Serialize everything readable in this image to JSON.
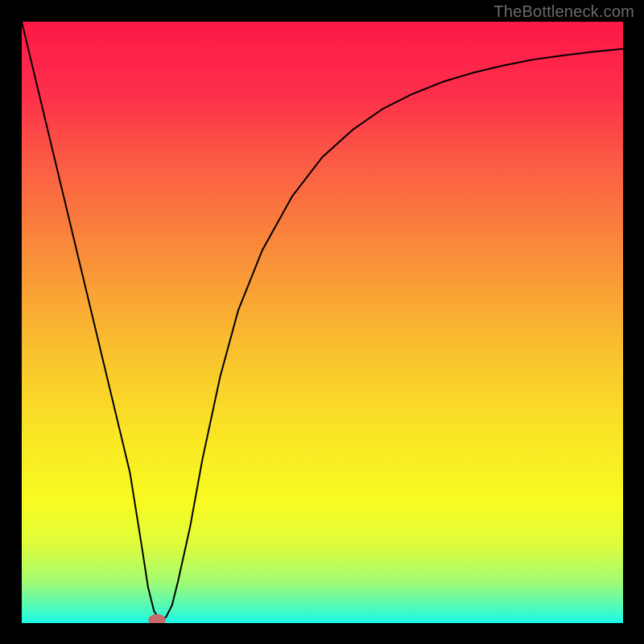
{
  "watermark": "TheBottleneck.com",
  "chart_data": {
    "type": "line",
    "title": "",
    "xlabel": "",
    "ylabel": "",
    "xlim": [
      0,
      100
    ],
    "ylim": [
      0,
      100
    ],
    "grid": false,
    "legend": false,
    "background_gradient": {
      "type": "vertical",
      "stops": [
        {
          "offset": 0.0,
          "color": "#fd1847"
        },
        {
          "offset": 0.12,
          "color": "#fd2f4b"
        },
        {
          "offset": 0.25,
          "color": "#fb6143"
        },
        {
          "offset": 0.4,
          "color": "#f99239"
        },
        {
          "offset": 0.55,
          "color": "#f9c22e"
        },
        {
          "offset": 0.7,
          "color": "#f9e924"
        },
        {
          "offset": 0.8,
          "color": "#f8fb22"
        },
        {
          "offset": 0.87,
          "color": "#defc3c"
        },
        {
          "offset": 0.93,
          "color": "#a4fb70"
        },
        {
          "offset": 0.97,
          "color": "#57fab3"
        },
        {
          "offset": 1.0,
          "color": "#1afae9"
        }
      ]
    },
    "series": [
      {
        "name": "bottleneck-curve",
        "color": "#000000",
        "stroke_width": 2,
        "x": [
          0,
          3,
          6,
          9,
          12,
          15,
          18,
          20,
          21,
          22,
          23,
          24,
          25,
          26,
          28,
          30,
          33,
          36,
          40,
          45,
          50,
          55,
          60,
          65,
          70,
          75,
          80,
          85,
          90,
          95,
          100
        ],
        "y": [
          100,
          87.5,
          75,
          62.5,
          50,
          37.5,
          25,
          12.5,
          6,
          2,
          0.5,
          1,
          3,
          7,
          16,
          27,
          41,
          52,
          62,
          71,
          77.5,
          82,
          85.5,
          88,
          90,
          91.5,
          92.7,
          93.7,
          94.4,
          95,
          95.5
        ]
      }
    ],
    "marker": {
      "name": "bottleneck-point",
      "x": 22.5,
      "y": 0.5,
      "shape": "ellipse",
      "rx": 1.4,
      "ry": 0.9,
      "fill": "#c76a6a",
      "stroke": "#c76a6a"
    }
  }
}
